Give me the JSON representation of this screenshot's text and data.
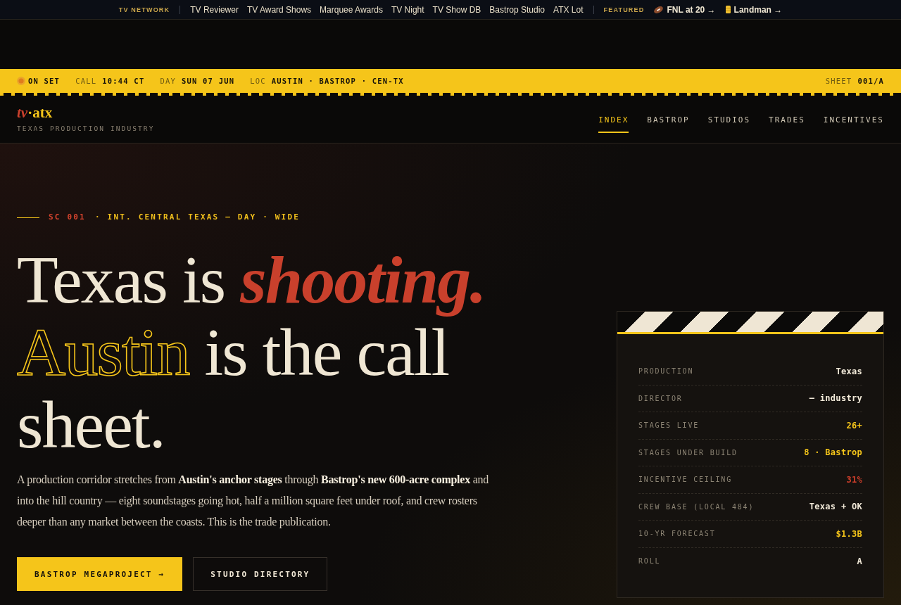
{
  "top_bar": {
    "network_label": "TV NETWORK",
    "links": [
      "TV Reviewer",
      "TV Award Shows",
      "Marquee Awards",
      "TV Night",
      "TV Show DB",
      "Bastrop Studio",
      "ATX Lot"
    ],
    "featured_label": "FEATURED",
    "featured": [
      {
        "kind": "football",
        "label": "FNL at 20 →"
      },
      {
        "kind": "barrel",
        "label": "Landman →"
      }
    ]
  },
  "status_strip": {
    "status": "ON SET",
    "fields": [
      {
        "label": "CALL",
        "value": "10:44 CT"
      },
      {
        "label": "DAY",
        "value": "SUN 07 JUN"
      },
      {
        "label": "LOC",
        "value": "AUSTIN · BASTROP · CEN-TX"
      }
    ],
    "sheet": {
      "label": "SHEET",
      "value": "001/A"
    }
  },
  "header": {
    "logo": "*tv*·atx",
    "tagline": "TEXAS PRODUCTION INDUSTRY",
    "nav": [
      {
        "label": "INDEX",
        "selected": true
      },
      {
        "label": "BASTROP",
        "selected": false
      },
      {
        "label": "STUDIOS",
        "selected": false
      },
      {
        "label": "TRADES",
        "selected": false
      },
      {
        "label": "INCENTIVES",
        "selected": false
      }
    ]
  },
  "hero": {
    "slug": {
      "scene": "SC 001",
      "heading": "· INT. CENTRAL TEXAS — DAY · WIDE"
    },
    "headline": "Texas is *shooting.* **Austin** is the call sheet.",
    "body": "A production corridor stretches from **Austin's anchor stages** through **Bastrop's new 600-acre complex** and into the hill country — eight soundstages going hot, half a million square feet under roof, and crew rosters deeper than any market between the coasts. This is the trade publication.",
    "buttons": [
      {
        "kind": "primary",
        "label": "BASTROP MEGAPROJECT →"
      },
      {
        "kind": "secondary",
        "label": "STUDIO DIRECTORY"
      }
    ]
  },
  "call_sheet": {
    "rows": [
      {
        "label": "PRODUCTION",
        "value": "Texas",
        "color": "#f1e9d8"
      },
      {
        "label": "DIRECTOR",
        "value": "— industry",
        "color": "#f1e9d8"
      },
      {
        "label": "STAGES LIVE",
        "value": "26+",
        "color": "#f5c51a"
      },
      {
        "label": "STAGES UNDER BUILD",
        "value": "8 · Bastrop",
        "color": "#f5c51a"
      },
      {
        "label": "INCENTIVE CEILING",
        "value": "31%",
        "color": "#d23f2b"
      },
      {
        "label": "CREW BASE (LOCAL 484)",
        "value": "Texas + OK",
        "color": "#f1e9d8"
      },
      {
        "label": "10-YR FORECAST",
        "value": "$1.3B",
        "color": "#f5c51a"
      },
      {
        "label": "ROLL",
        "value": "A",
        "color": "#f1e9d8"
      }
    ]
  }
}
